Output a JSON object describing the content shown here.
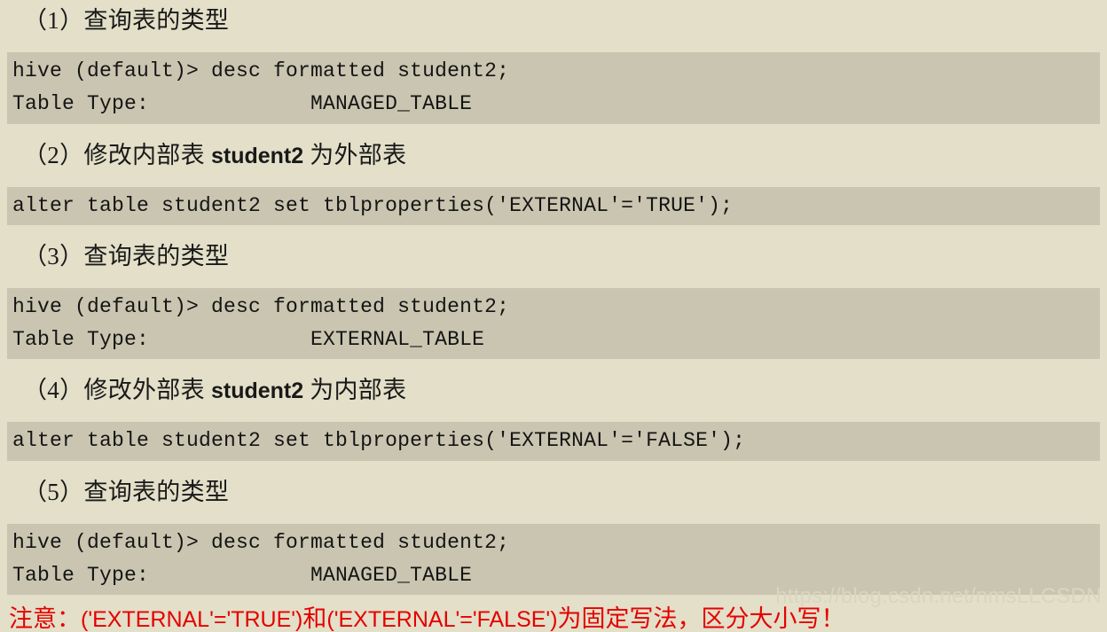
{
  "sections": [
    {
      "heading_prefix": "（1）",
      "heading_text": "查询表的类型",
      "heading_name": "",
      "heading_suffix": "",
      "code_lines": [
        "hive (default)> desc formatted student2;",
        "Table Type:             MANAGED_TABLE"
      ]
    },
    {
      "heading_prefix": "（2）",
      "heading_text": "修改内部表 ",
      "heading_name": "student2",
      "heading_suffix": " 为外部表",
      "code_lines": [
        "alter table student2 set tblproperties('EXTERNAL'='TRUE');"
      ]
    },
    {
      "heading_prefix": "（3）",
      "heading_text": "查询表的类型",
      "heading_name": "",
      "heading_suffix": "",
      "code_lines": [
        "hive (default)> desc formatted student2;",
        "Table Type:             EXTERNAL_TABLE"
      ]
    },
    {
      "heading_prefix": "（4）",
      "heading_text": "修改外部表 ",
      "heading_name": "student2",
      "heading_suffix": " 为内部表",
      "code_lines": [
        "alter table student2 set tblproperties('EXTERNAL'='FALSE');"
      ]
    },
    {
      "heading_prefix": "（5）",
      "heading_text": "查询表的类型",
      "heading_name": "",
      "heading_suffix": "",
      "code_lines": [
        "hive (default)> desc formatted student2;",
        "Table Type:             MANAGED_TABLE"
      ]
    }
  ],
  "note": {
    "lead": "注意：",
    "code_a": "('EXTERNAL'='TRUE')",
    "mid": "和",
    "code_b": "('EXTERNAL'='FALSE')",
    "tail": "为固定写法，区分大小写！"
  },
  "watermark": {
    "text": "https://blog.csdn.net/nmsLLCSDN"
  },
  "colors": {
    "page_background": "#e3dfc8",
    "code_background": "#c9c5b0",
    "text": "#191919",
    "note_red": "#e50000",
    "watermark": "#d9d6c0"
  }
}
